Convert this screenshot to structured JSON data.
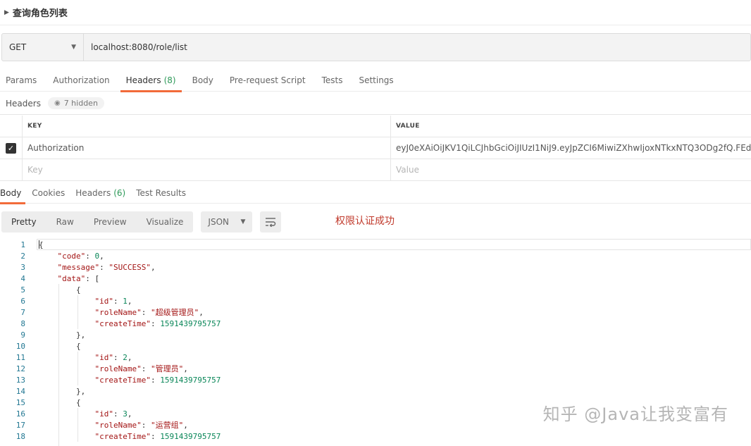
{
  "request": {
    "title": "查询角色列表",
    "method": "GET",
    "url": "localhost:8080/role/list"
  },
  "tabs": [
    {
      "label": "Params"
    },
    {
      "label": "Authorization"
    },
    {
      "label": "Headers",
      "count": "(8)"
    },
    {
      "label": "Body"
    },
    {
      "label": "Pre-request Script"
    },
    {
      "label": "Tests"
    },
    {
      "label": "Settings"
    }
  ],
  "headers_section": {
    "label": "Headers",
    "hidden": "7 hidden"
  },
  "kv_table": {
    "key_header": "KEY",
    "value_header": "VALUE",
    "row_key": "Authorization",
    "row_value": "eyJ0eXAiOiJKV1QiLCJhbGciOiJIUzI1NiJ9.eyJpZCI6MiwiZXhwIjoxNTkxNTQ3ODg2fQ.FEdGD5v...",
    "key_placeholder": "Key",
    "value_placeholder": "Value"
  },
  "response_tabs": [
    {
      "label": "Body"
    },
    {
      "label": "Cookies"
    },
    {
      "label": "Headers",
      "count": "(6)"
    },
    {
      "label": "Test Results"
    }
  ],
  "toolbar": {
    "views": [
      "Pretty",
      "Raw",
      "Preview",
      "Visualize"
    ],
    "format": "JSON"
  },
  "annotation": "权限认证成功",
  "line_numbers": [
    "1",
    "2",
    "3",
    "4",
    "5",
    "6",
    "7",
    "8",
    "9",
    "10",
    "11",
    "12",
    "13",
    "14",
    "15",
    "16",
    "17",
    "18"
  ],
  "json": {
    "code": "0",
    "message": "\"SUCCESS\"",
    "items": [
      {
        "id": "1",
        "roleName": "\"超级管理员\"",
        "createTime": "1591439795757"
      },
      {
        "id": "2",
        "roleName": "\"管理员\"",
        "createTime": "1591439795757"
      },
      {
        "id": "3",
        "roleName": "\"运营组\"",
        "createTime": "1591439795757"
      }
    ]
  },
  "watermark": "知乎 @Java让我变富有",
  "colors": {
    "accent": "#f26b3a",
    "count_green": "#2f9a5a",
    "annotation_red": "#c0392b",
    "json_key": "#a31515",
    "json_number": "#098658"
  }
}
